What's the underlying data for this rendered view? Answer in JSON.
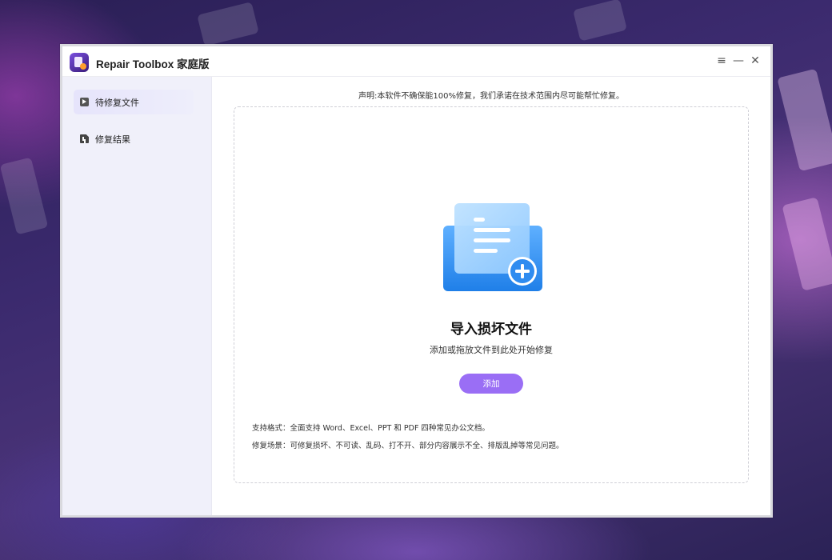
{
  "window": {
    "title": "Repair Toolbox 家庭版",
    "controls": [
      "menu-icon",
      "minimize-icon",
      "close-icon"
    ]
  },
  "sidebar": {
    "items": [
      {
        "label": "待修复文件",
        "icon": "pending-files-icon",
        "active": true
      },
      {
        "label": "修复结果",
        "icon": "repair-results-icon",
        "active": false
      }
    ]
  },
  "main": {
    "disclaimer": "声明:本软件不确保能100%修复，我们承诺在技术范围内尽可能帮忙修复。",
    "dropzone": {
      "illustration": "add-file-icon",
      "title": "导入损坏文件",
      "subtitle": "添加或拖放文件到此处开始修复",
      "add_button": "添加",
      "supported_formats": "支持格式：全面支持 Word、Excel、PPT 和 PDF 四种常见办公文档。",
      "repair_scenarios": "修复场景：可修复损坏、不可读、乱码、打不开、部分内容展示不全、排版乱掉等常见问题。"
    }
  },
  "colors": {
    "accent": "#9a6ef5",
    "sidebar_bg": "#f0f0fa",
    "illustration_blue": "#2f8cf0"
  }
}
